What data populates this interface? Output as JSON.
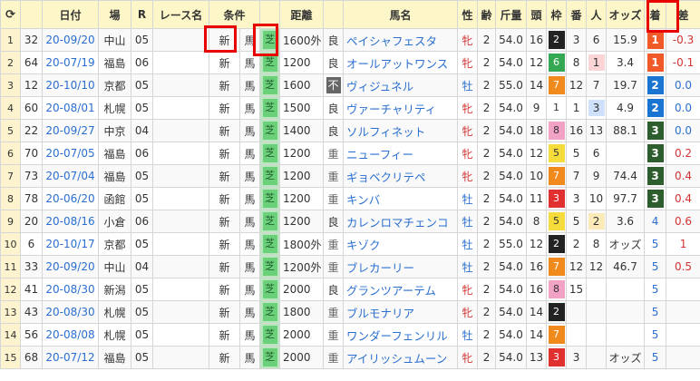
{
  "headers": {
    "refresh": "⟳",
    "date": "日付",
    "venue": "場",
    "race_no": "R",
    "race_name": "レース名",
    "condition": "条件",
    "distance": "距離",
    "horse_name": "馬名",
    "sex": "性",
    "age": "齢",
    "weight": "斤量",
    "heads": "頭",
    "waku": "枠",
    "umaban": "番",
    "ninki": "人",
    "odds": "オッズ",
    "rank": "着",
    "diff": "差"
  },
  "colors": {
    "waku": {
      "1": "#ffffff",
      "2": "#222222",
      "3": "#e03030",
      "4": "#2f6be0",
      "5": "#f5dc3c",
      "6": "#34a853",
      "7": "#f08a1c",
      "8": "#f2a2c5"
    },
    "rank": {
      "1": "#f05a28",
      "2": "#1a75d2",
      "3": "#2e5e2e"
    },
    "ninki": {
      "1": "#fbd5d5",
      "2": "#fce9b8",
      "3": "#cfe0fa"
    }
  },
  "rows": [
    {
      "idx": "1",
      "n": "32",
      "date": "20-09/20",
      "venue": "中山",
      "r": "05",
      "rname": "",
      "cls": "新",
      "horse": "馬",
      "surf": "芝",
      "dist": "1600外",
      "track": "良",
      "name": "ペイシャフェスタ",
      "sex": "牝",
      "age": "2",
      "wt": "54.0",
      "heads": "16",
      "waku": "2",
      "ban": "3",
      "ninki": "6",
      "odds": "15.9",
      "rank": "1",
      "diff": "-0.3"
    },
    {
      "idx": "2",
      "n": "64",
      "date": "20-07/19",
      "venue": "福島",
      "r": "06",
      "rname": "",
      "cls": "新",
      "horse": "馬",
      "surf": "芝",
      "dist": "1200",
      "track": "良",
      "name": "オールアットワンス",
      "sex": "牝",
      "age": "2",
      "wt": "54.0",
      "heads": "12",
      "waku": "6",
      "ban": "8",
      "ninki": "1",
      "odds": "3.4",
      "rank": "1",
      "diff": "-0.1"
    },
    {
      "idx": "3",
      "n": "12",
      "date": "20-10/10",
      "venue": "京都",
      "r": "05",
      "rname": "",
      "cls": "新",
      "horse": "馬",
      "surf": "芝",
      "dist": "1600",
      "track": "不",
      "name": "ヴィジュネル",
      "sex": "牡",
      "age": "2",
      "wt": "55.0",
      "heads": "14",
      "waku": "7",
      "ban": "12",
      "ninki": "7",
      "odds": "19.7",
      "rank": "2",
      "diff": "0.0"
    },
    {
      "idx": "4",
      "n": "60",
      "date": "20-08/01",
      "venue": "札幌",
      "r": "05",
      "rname": "",
      "cls": "新",
      "horse": "馬",
      "surf": "芝",
      "dist": "1500",
      "track": "良",
      "name": "ヴァーチャリティ",
      "sex": "牝",
      "age": "2",
      "wt": "54.0",
      "heads": "9",
      "waku": "1",
      "ban": "1",
      "ninki": "3",
      "odds": "4.9",
      "rank": "2",
      "diff": "0.0"
    },
    {
      "idx": "5",
      "n": "22",
      "date": "20-09/27",
      "venue": "中京",
      "r": "04",
      "rname": "",
      "cls": "新",
      "horse": "馬",
      "surf": "芝",
      "dist": "1400",
      "track": "良",
      "name": "ソルフィネット",
      "sex": "牝",
      "age": "2",
      "wt": "54.0",
      "heads": "18",
      "waku": "8",
      "ban": "16",
      "ninki": "13",
      "odds": "88.1",
      "rank": "3",
      "diff": "0.0"
    },
    {
      "idx": "6",
      "n": "70",
      "date": "20-07/05",
      "venue": "福島",
      "r": "06",
      "rname": "",
      "cls": "新",
      "horse": "馬",
      "surf": "芝",
      "dist": "1200",
      "track": "重",
      "name": "ニューフィー",
      "sex": "牝",
      "age": "2",
      "wt": "54.0",
      "heads": "12",
      "waku": "5",
      "ban": "5",
      "ninki": "6",
      "odds": "",
      "rank": "3",
      "diff": "0.2"
    },
    {
      "idx": "7",
      "n": "73",
      "date": "20-07/04",
      "venue": "福島",
      "r": "05",
      "rname": "",
      "cls": "新",
      "horse": "馬",
      "surf": "芝",
      "dist": "1200",
      "track": "重",
      "name": "ギョベクリテペ",
      "sex": "牝",
      "age": "2",
      "wt": "54.0",
      "heads": "10",
      "waku": "7",
      "ban": "7",
      "ninki": "9",
      "odds": "74.4",
      "rank": "3",
      "diff": "0.4"
    },
    {
      "idx": "8",
      "n": "78",
      "date": "20-06/20",
      "venue": "函館",
      "r": "05",
      "rname": "",
      "cls": "新",
      "horse": "馬",
      "surf": "芝",
      "dist": "1200",
      "track": "重",
      "name": "キンバ",
      "sex": "牡",
      "age": "2",
      "wt": "54.0",
      "heads": "11",
      "waku": "3",
      "ban": "3",
      "ninki": "10",
      "odds": "97.7",
      "rank": "3",
      "diff": "0.4"
    },
    {
      "idx": "9",
      "n": "20",
      "date": "20-08/16",
      "venue": "小倉",
      "r": "06",
      "rname": "",
      "cls": "新",
      "horse": "馬",
      "surf": "芝",
      "dist": "1200",
      "track": "良",
      "name": "カレンロマチェンコ",
      "sex": "牡",
      "age": "2",
      "wt": "54.0",
      "heads": "8",
      "waku": "5",
      "ban": "5",
      "ninki": "2",
      "odds": "3.6",
      "rank": "4",
      "diff": "0.6"
    },
    {
      "idx": "10",
      "n": "6",
      "date": "20-10/17",
      "venue": "京都",
      "r": "05",
      "rname": "",
      "cls": "新",
      "horse": "馬",
      "surf": "芝",
      "dist": "1800外",
      "track": "重",
      "name": "キゾク",
      "sex": "牡",
      "age": "2",
      "wt": "55.0",
      "heads": "12",
      "waku": "2",
      "ban": "2",
      "ninki": "8",
      "odds": "オッズ",
      "rank": "5",
      "diff": "1"
    },
    {
      "idx": "11",
      "n": "33",
      "date": "20-09/20",
      "venue": "中山",
      "r": "04",
      "rname": "",
      "cls": "新",
      "horse": "馬",
      "surf": "芝",
      "dist": "1200外",
      "track": "重",
      "name": "ブレカーリー",
      "sex": "牡",
      "age": "2",
      "wt": "54.0",
      "heads": "16",
      "waku": "7",
      "ban": "12",
      "ninki": "12",
      "odds": "46.7",
      "rank": "5",
      "diff": "0.5"
    },
    {
      "idx": "12",
      "n": "41",
      "date": "20-08/30",
      "venue": "新潟",
      "r": "05",
      "rname": "",
      "cls": "新",
      "horse": "馬",
      "surf": "芝",
      "dist": "2000",
      "track": "良",
      "name": "グランツアーテム",
      "sex": "牝",
      "age": "2",
      "wt": "54.0",
      "heads": "16",
      "waku": "8",
      "ban": "15",
      "ninki": "",
      "odds": "",
      "rank": "5",
      "diff": ""
    },
    {
      "idx": "13",
      "n": "43",
      "date": "20-08/30",
      "venue": "札幌",
      "r": "05",
      "rname": "",
      "cls": "新",
      "horse": "馬",
      "surf": "芝",
      "dist": "1800",
      "track": "重",
      "name": "ブルモナリア",
      "sex": "牝",
      "age": "2",
      "wt": "54.0",
      "heads": "14",
      "waku": "2",
      "ban": "",
      "ninki": "",
      "odds": "",
      "rank": "5",
      "diff": ""
    },
    {
      "idx": "14",
      "n": "56",
      "date": "20-08/08",
      "venue": "札幌",
      "r": "05",
      "rname": "",
      "cls": "新",
      "horse": "馬",
      "surf": "芝",
      "dist": "2000",
      "track": "重",
      "name": "ワンダーフェンリル",
      "sex": "牡",
      "age": "2",
      "wt": "54.0",
      "heads": "14",
      "waku": "7",
      "ban": "",
      "ninki": "",
      "odds": "",
      "rank": "5",
      "diff": ""
    },
    {
      "idx": "15",
      "n": "68",
      "date": "20-07/12",
      "venue": "福島",
      "r": "05",
      "rname": "",
      "cls": "新",
      "horse": "馬",
      "surf": "芝",
      "dist": "2000",
      "track": "重",
      "name": "アイリッシュムーン",
      "sex": "牝",
      "age": "2",
      "wt": "54.0",
      "heads": "13",
      "waku": "3",
      "ban": "3",
      "ninki": "",
      "odds": "オッズ",
      "rank": "5",
      "diff": ""
    }
  ]
}
